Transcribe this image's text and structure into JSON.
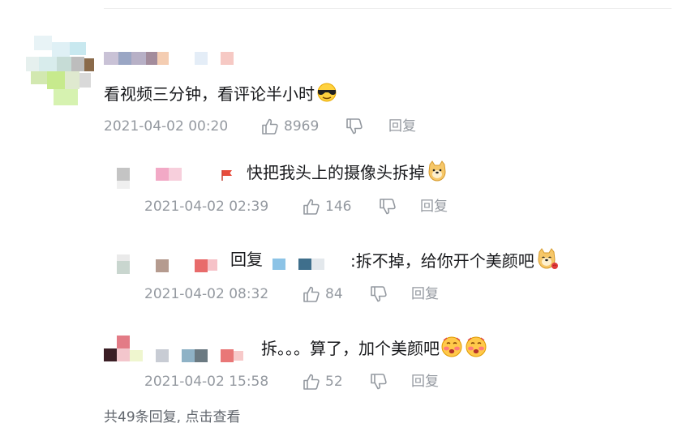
{
  "thread": {
    "main": {
      "content": "看视频三分钟，看评论半小时",
      "emoji": "sunglasses-face-emoji",
      "time": "2021-04-02 00:20",
      "likes": "8969",
      "reply_label": "回复"
    },
    "replies": [
      {
        "content": "快把我头上的摄像头拆掉",
        "emoji": "doge-emoji",
        "time": "2021-04-02 02:39",
        "likes": "146",
        "reply_label": "回复"
      },
      {
        "reply_prefix": "回复",
        "content": ":拆不掉，给你开个美颜吧",
        "emoji": "doge-rose-emoji",
        "time": "2021-04-02 08:32",
        "likes": "84",
        "reply_label": "回复"
      },
      {
        "content": "拆。。。算了，加个美颜吧",
        "emoji": "blushing-face-emoji",
        "time": "2021-04-02 15:58",
        "likes": "52",
        "reply_label": "回复"
      }
    ],
    "footer": "共49条回复, 点击查看"
  },
  "colors": {
    "meta_text": "#9499a0",
    "body_text": "#18191c",
    "footer_text": "#61666d",
    "divider": "#eeeeee"
  },
  "icons": [
    "thumbs-up-icon",
    "thumbs-down-icon",
    "flag-icon"
  ]
}
